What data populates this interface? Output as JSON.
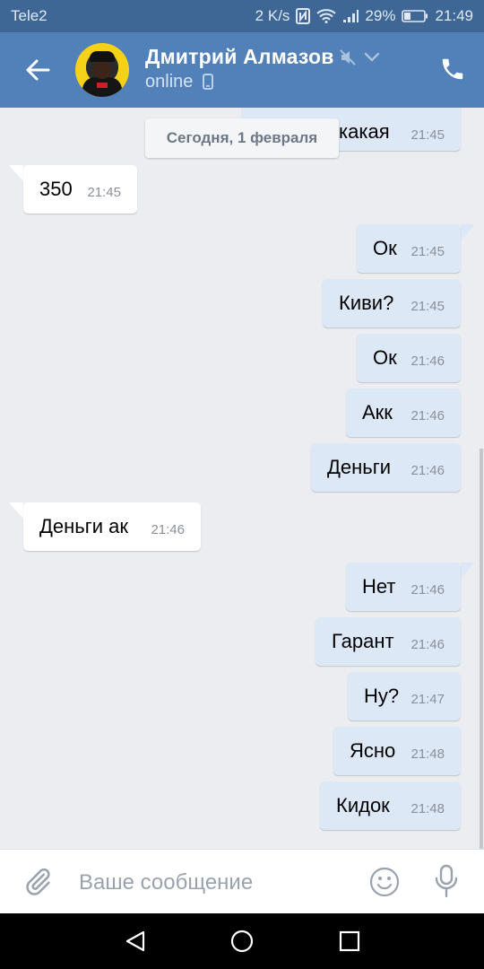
{
  "status_bar": {
    "carrier": "Tele2",
    "net_speed": "2 K/s",
    "battery": "29%",
    "time": "21:49"
  },
  "header": {
    "contact_name": "Дмитрий Алмазов",
    "status": "online"
  },
  "date_separator": "Сегодня, 1 февраля",
  "messages": [
    {
      "dir": "out",
      "text": "какая",
      "time": "21:45"
    },
    {
      "dir": "in",
      "text": "350",
      "time": "21:45"
    },
    {
      "dir": "out",
      "text": "Ок",
      "time": "21:45"
    },
    {
      "dir": "out",
      "text": "Киви?",
      "time": "21:45"
    },
    {
      "dir": "out",
      "text": "Ок",
      "time": "21:46"
    },
    {
      "dir": "out",
      "text": "Акк",
      "time": "21:46"
    },
    {
      "dir": "out",
      "text": "Деньги",
      "time": "21:46"
    },
    {
      "dir": "in",
      "text": "Деньги ак",
      "time": "21:46"
    },
    {
      "dir": "out",
      "text": "Нет",
      "time": "21:46"
    },
    {
      "dir": "out",
      "text": "Гарант",
      "time": "21:46"
    },
    {
      "dir": "out",
      "text": "Ну?",
      "time": "21:47"
    },
    {
      "dir": "out",
      "text": "Ясно",
      "time": "21:48"
    },
    {
      "dir": "out",
      "text": "Кидок",
      "time": "21:48"
    }
  ],
  "composer": {
    "placeholder": "Ваше сообщение"
  },
  "icons": {
    "back": "arrow-left-icon",
    "call": "phone-icon",
    "mute": "muted-speaker-icon",
    "dropdown": "chevron-down-icon",
    "attach": "paperclip-icon",
    "emoji": "smiley-icon",
    "voice": "microphone-icon"
  },
  "colors": {
    "header": "#5181b8",
    "status_bar": "#3e6796",
    "outgoing_bubble": "#dde8f7",
    "incoming_bubble": "#ffffff",
    "chat_background": "#ebedf0"
  }
}
